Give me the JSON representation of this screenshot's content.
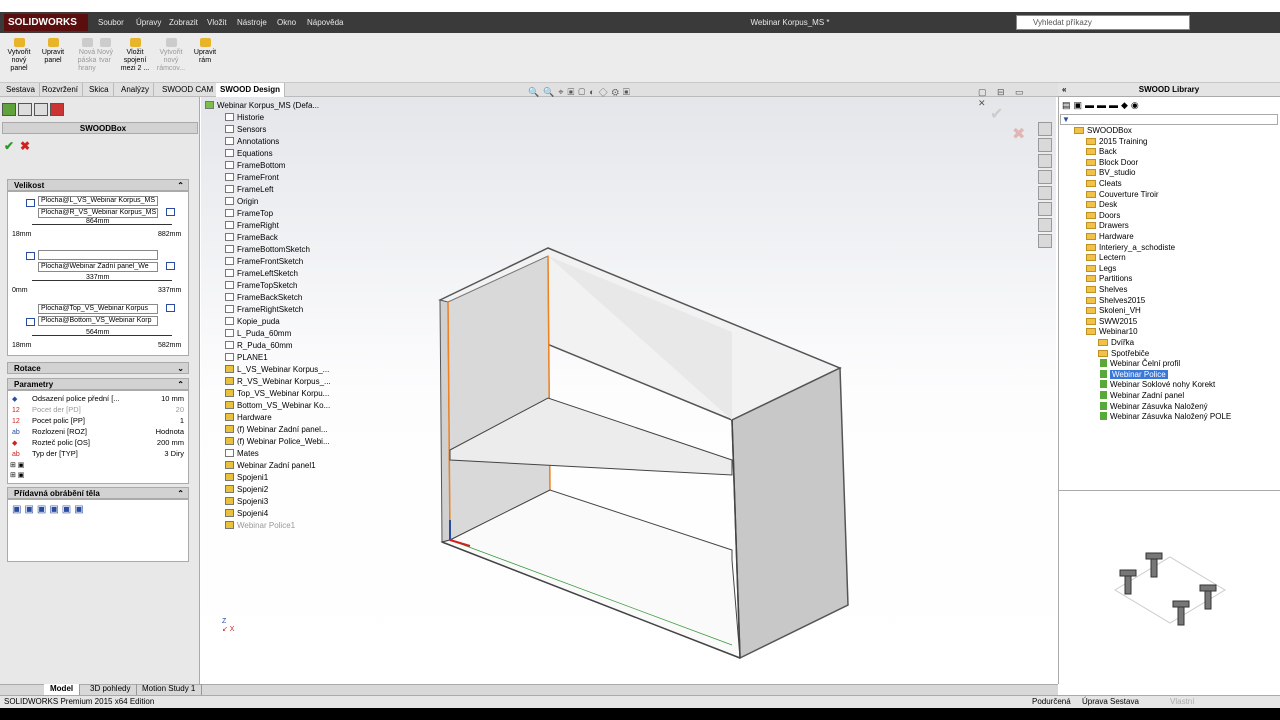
{
  "app": {
    "name": "SOLIDWORKS",
    "doc_title": "Webinar Korpus_MS *",
    "search_placeholder": "Vyhledat příkazy"
  },
  "menu": [
    "Soubor",
    "Úpravy",
    "Zobrazit",
    "Vložit",
    "Nástroje",
    "Okno",
    "Nápověda"
  ],
  "ribbon": [
    {
      "label": "Vytvořit\nnový\npanel",
      "enabled": true
    },
    {
      "label": "Upravit\npanel",
      "enabled": true
    },
    {
      "label": "Nová\npáska\nhrany",
      "enabled": false
    },
    {
      "label": "Nový\ntvar",
      "enabled": false
    },
    {
      "label": "Vložit\nspojení\nmezi 2 ...",
      "enabled": true
    },
    {
      "label": "Vytvořit\nnový\nrámcov...",
      "enabled": false
    },
    {
      "label": "Upravit\nrám",
      "enabled": true
    }
  ],
  "tabs": [
    "Sestava",
    "Rozvržení",
    "Skica",
    "Analýzy",
    "SWOOD CAM",
    "SWOOD Design"
  ],
  "property_manager": {
    "title": "SWOODBox",
    "velikost": {
      "title": "Velikost",
      "field1": "Plocha@L_VS_Webinar Korpus_MS",
      "field2": "Plocha@R_VS_Webinar Korpus_MS",
      "dim1": "864mm",
      "min1": "18mm",
      "max1": "882mm",
      "field3": "",
      "field4": "Plocha@Webinar Zadní panel_We",
      "dim2": "337mm",
      "min2": "0mm",
      "max2": "337mm",
      "field5": "Plocha@Top_VS_Webinar Korpus",
      "field6": "Plocha@Bottom_VS_Webinar Korp",
      "dim3": "564mm",
      "min3": "18mm",
      "max3": "582mm"
    },
    "rotace": "Rotace",
    "parametry": {
      "title": "Parametry",
      "rows": [
        {
          "label": "Odsazení police přední [...",
          "value": "10 mm",
          "enabled": true
        },
        {
          "label": "Pocet der [PD]",
          "value": "20",
          "enabled": false
        },
        {
          "label": "Pocet polic [PP]",
          "value": "1",
          "enabled": true
        },
        {
          "label": "Rozlozeni [ROZ]",
          "value": "Hodnota",
          "enabled": true
        },
        {
          "label": "Rozteč polic [OS]",
          "value": "200 mm",
          "enabled": true
        },
        {
          "label": "Typ der [TYP]",
          "value": "3 Diry",
          "enabled": true
        }
      ]
    },
    "pridavna": "Přídavná obrábění těla"
  },
  "feature_tree": {
    "root": "Webinar Korpus_MS (Defa...",
    "items": [
      "Historie",
      "Sensors",
      "Annotations",
      "Equations",
      "FrameBottom",
      "FrameFront",
      "FrameLeft",
      "Origin",
      "FrameTop",
      "FrameRight",
      "FrameBack",
      "FrameBottomSketch",
      "FrameFrontSketch",
      "FrameLeftSketch",
      "FrameTopSketch",
      "FrameBackSketch",
      "FrameRightSketch",
      "Kopie_puda",
      "L_Puda_60mm",
      "R_Puda_60mm",
      "PLANE1",
      "L_VS_Webinar Korpus_...",
      "R_VS_Webinar Korpus_...",
      "Top_VS_Webinar Korpu...",
      "Bottom_VS_Webinar Ko...",
      "Hardware",
      "(f) Webinar Zadní panel...",
      "(f) Webinar Police_Webi...",
      "Mates",
      "Webinar Zadní panel1",
      "Spojeni1",
      "Spojeni2",
      "Spojeni3",
      "Spojeni4",
      "Webinar Police1"
    ]
  },
  "library": {
    "title": "SWOOD Library",
    "root": "SWOODBox",
    "folders": [
      "2015 Training",
      "Back",
      "Block Door",
      "BV_studio",
      "Cleats",
      "Couverture Tiroir",
      "Desk",
      "Doors",
      "Drawers",
      "Hardware",
      "Interiery_a_schodiste",
      "Lectern",
      "Legs",
      "Partitions",
      "Shelves",
      "Shelves2015",
      "Skoleni_VH",
      "SWW2015",
      "Webinar10"
    ],
    "subfolders": [
      "Dvířka",
      "Spotřebiče"
    ],
    "parts": [
      "Webinar Čelní profil",
      "Webinar Police",
      "Webinar Soklové nohy Korekt",
      "Webinar Zadní panel",
      "Webinar Zásuvka Naložený",
      "Webinar Zásuvka Naložený POLE"
    ],
    "selected": "Webinar Police"
  },
  "bottom_tabs": [
    "Model",
    "3D pohledy",
    "Motion Study 1"
  ],
  "status": {
    "left": "SOLIDWORKS Premium 2015 x64 Edition",
    "mid1": "Podurčená",
    "mid2": "Úprava Sestava",
    "mid3": "Vlastní"
  },
  "colors": {
    "accent": "#3a78d8",
    "brand": "#5b0e0e",
    "folder": "#f0c24a"
  }
}
